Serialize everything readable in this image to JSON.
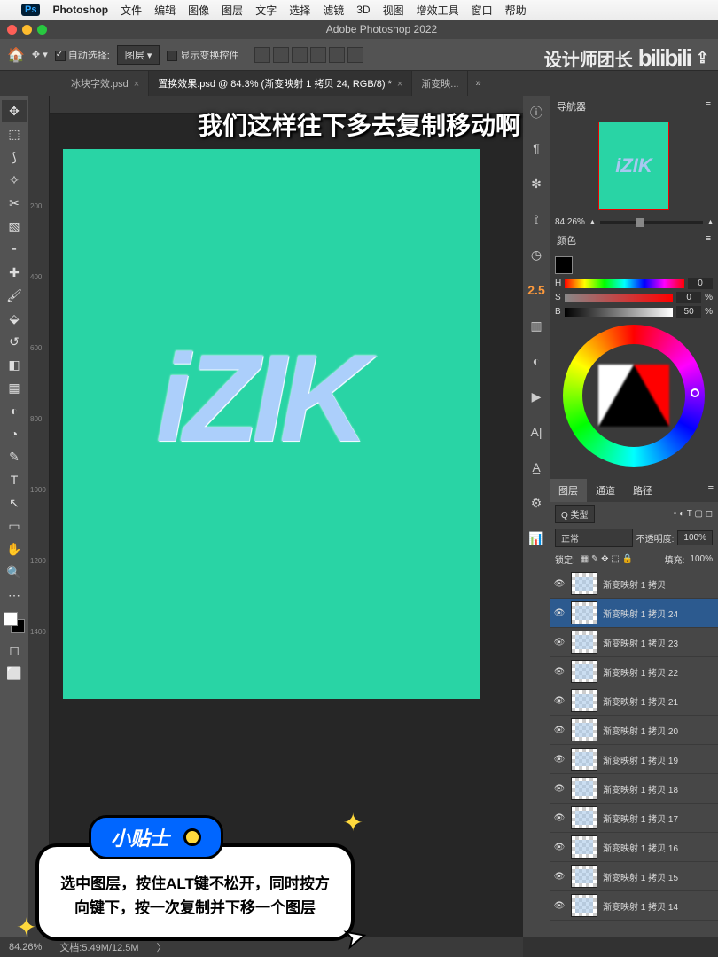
{
  "mac_menu": {
    "app": "Photoshop",
    "items": [
      "文件",
      "编辑",
      "图像",
      "图层",
      "文字",
      "选择",
      "滤镜",
      "3D",
      "视图",
      "增效工具",
      "窗口",
      "帮助"
    ]
  },
  "window": {
    "title": "Adobe Photoshop 2022"
  },
  "option_bar": {
    "auto_select": "自动选择:",
    "layer_dd": "图层",
    "show_transform": "显示变换控件"
  },
  "tabs": [
    {
      "label": "冰块字效.psd"
    },
    {
      "label": "置换效果.psd @ 84.3% (渐变映射 1 拷贝 24, RGB/8) *",
      "active": true
    },
    {
      "label": "渐变映..."
    }
  ],
  "subtitle": "我们这样往下多去复制移动啊",
  "watermark": {
    "text": "设计师团长",
    "brand": "bilibili"
  },
  "navigator": {
    "title": "导航器",
    "zoom": "84.26%"
  },
  "dock_badge": "2.5",
  "color": {
    "title": "颜色",
    "h": {
      "label": "H",
      "value": "0"
    },
    "s": {
      "label": "S",
      "value": "0",
      "unit": "%"
    },
    "b": {
      "label": "B",
      "value": "50",
      "unit": "%"
    }
  },
  "layers_panel": {
    "tabs": [
      "图层",
      "通道",
      "路径"
    ],
    "filter": "Q 类型",
    "blend": "正常",
    "opacity_label": "不透明度:",
    "opacity": "100%",
    "lock_label": "锁定:",
    "fill_label": "填充:",
    "fill": "100%",
    "layers": [
      {
        "name": "渐变映射 1 拷贝"
      },
      {
        "name": "渐变映射 1 拷贝 24",
        "selected": true
      },
      {
        "name": "渐变映射 1 拷贝 23"
      },
      {
        "name": "渐变映射 1 拷贝 22"
      },
      {
        "name": "渐变映射 1 拷贝 21"
      },
      {
        "name": "渐变映射 1 拷贝 20"
      },
      {
        "name": "渐变映射 1 拷贝 19"
      },
      {
        "name": "渐变映射 1 拷贝 18"
      },
      {
        "name": "渐变映射 1 拷贝 17"
      },
      {
        "name": "渐变映射 1 拷贝 16"
      },
      {
        "name": "渐变映射 1 拷贝 15"
      },
      {
        "name": "渐变映射 1 拷贝 14"
      }
    ]
  },
  "tip": {
    "title": "小贴士",
    "body": "选中图层，按住ALT键不松开，同时按方向键下，按一次复制并下移一个图层"
  },
  "status": {
    "zoom": "84.26%",
    "doc": "文档:5.49M/12.5M"
  },
  "canvas_text": "iZIK"
}
